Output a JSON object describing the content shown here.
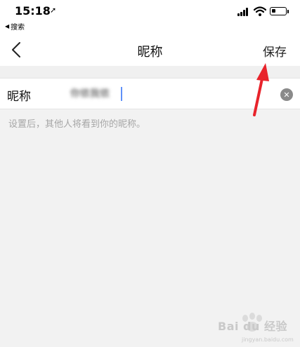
{
  "status_bar": {
    "time": "15:18",
    "back_to_app_label": "搜索",
    "icons": [
      "location-arrow-icon",
      "cellular-signal-icon",
      "wifi-icon",
      "battery-icon"
    ],
    "battery_level": 0.3
  },
  "nav_bar": {
    "title": "昵称",
    "save_label": "保存",
    "back_icon": "chevron-left-icon"
  },
  "nickname_field": {
    "label": "昵称",
    "value": "你侬我侬",
    "clear_icon": "clear-circle-icon"
  },
  "hint": {
    "text": "设置后，其他人将看到你的昵称。"
  },
  "watermark": {
    "text": "Bai du 经验",
    "sub_text": "jingyan.baidu.com"
  },
  "colors": {
    "background": "#f2f2f2",
    "annotation_arrow": "#e8232b",
    "caret": "#2b6cf6"
  }
}
